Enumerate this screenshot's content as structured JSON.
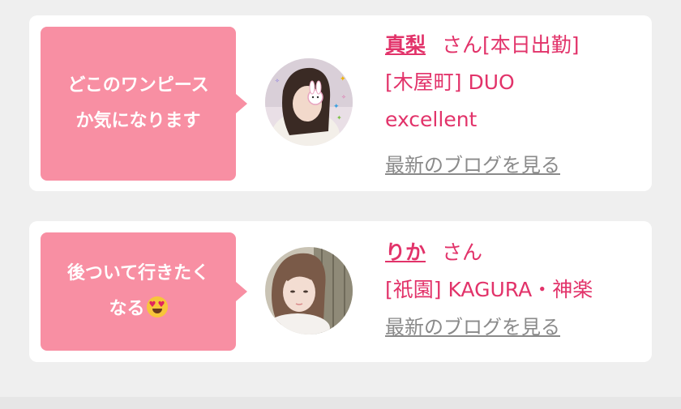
{
  "posts": [
    {
      "comment_lines": [
        "どこのワンピース",
        "か気になります"
      ],
      "name": "真梨",
      "honorific": "さん[本日出勤]",
      "shop_lines": [
        "[木屋町] DUO",
        "excellent"
      ],
      "blog_link": "最新のブログを見る"
    },
    {
      "comment_lines": [
        "後ついて行きたく",
        "なる"
      ],
      "comment_emoji": "heart-eyes-emoji",
      "name": "りか",
      "honorific": "さん",
      "shop_lines": [
        "[祇園] KAGURA・神楽"
      ],
      "blog_link": "最新のブログを見る"
    }
  ],
  "colors": {
    "bubble": "#f88fa3",
    "accent": "#e2336a",
    "link_gray": "#8a8a8a",
    "background": "#efefef"
  }
}
